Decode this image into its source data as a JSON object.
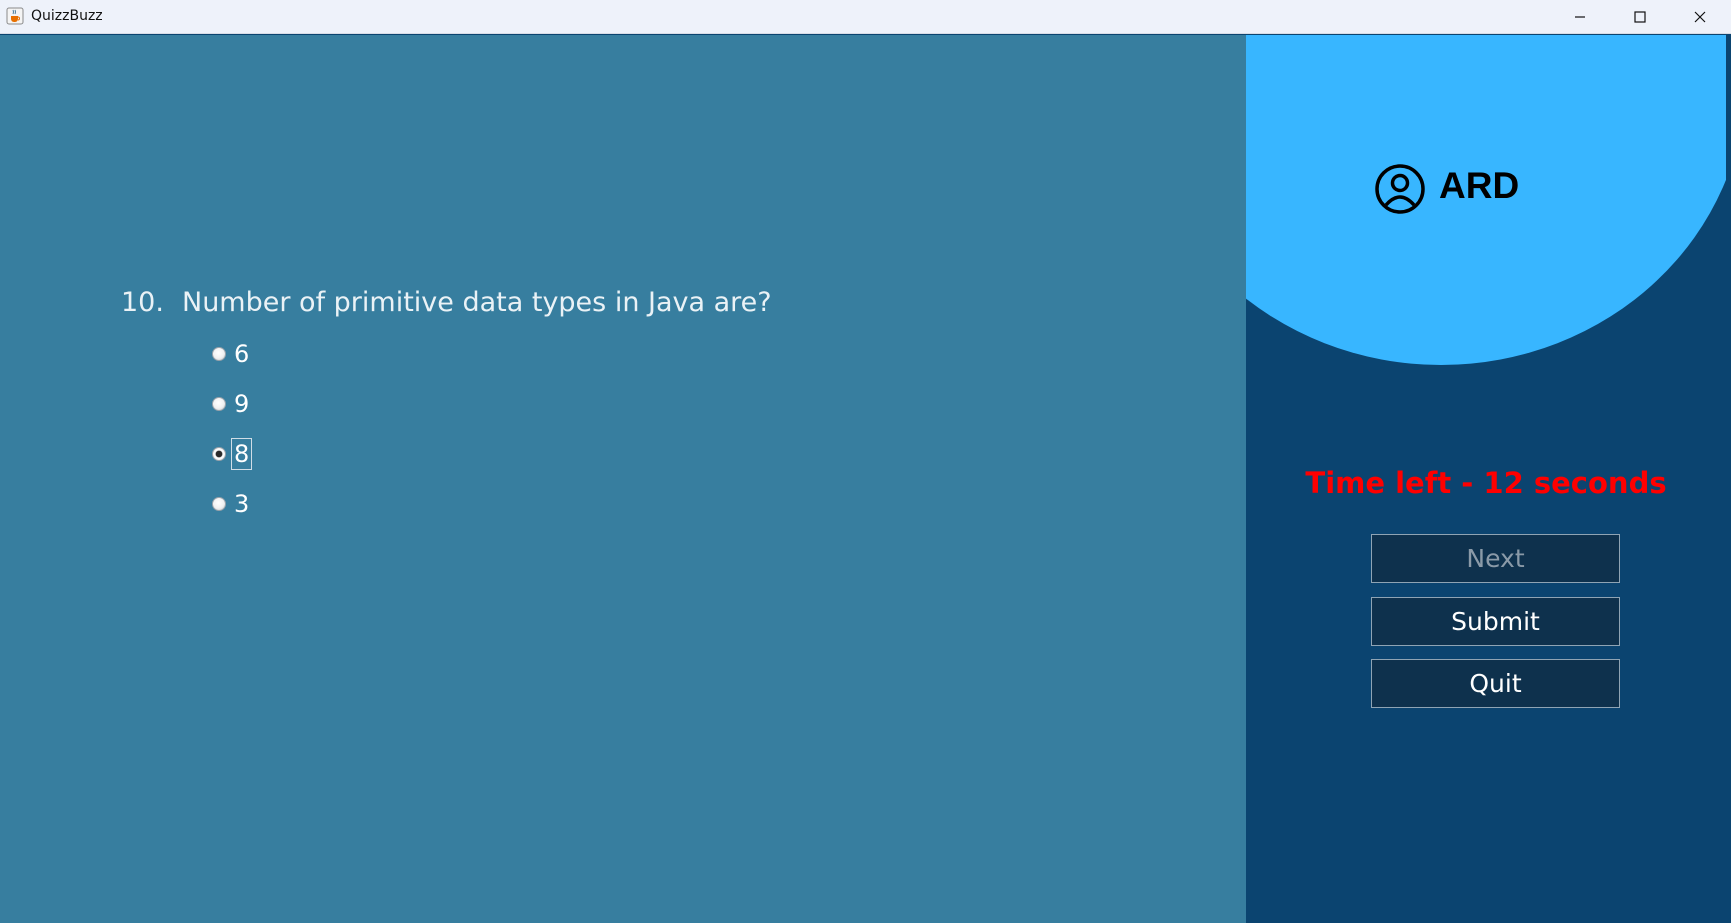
{
  "window": {
    "title": "QuizzBuzz",
    "icon": "java-cup-icon",
    "controls": [
      "minimize-icon",
      "maximize-icon",
      "close-icon"
    ]
  },
  "question": {
    "number": "10.",
    "text": "Number of primitive data types in Java are?",
    "options": [
      {
        "label": "6",
        "selected": false
      },
      {
        "label": "9",
        "selected": false
      },
      {
        "label": "8",
        "selected": true
      },
      {
        "label": "3",
        "selected": false
      }
    ]
  },
  "sidebar": {
    "user_icon": "user-circle-icon",
    "username": "ARD",
    "timer_text": "Time left - 12 seconds",
    "buttons": {
      "next": {
        "label": "Next",
        "enabled": false
      },
      "submit": {
        "label": "Submit",
        "enabled": true
      },
      "quit": {
        "label": "Quit",
        "enabled": true
      }
    }
  },
  "colors": {
    "main_bg": "#377e9f",
    "sidebar_bg": "#0b4470",
    "profile_circle": "#38b6ff",
    "timer": "#ff0000",
    "button_bg": "#0e314d"
  }
}
